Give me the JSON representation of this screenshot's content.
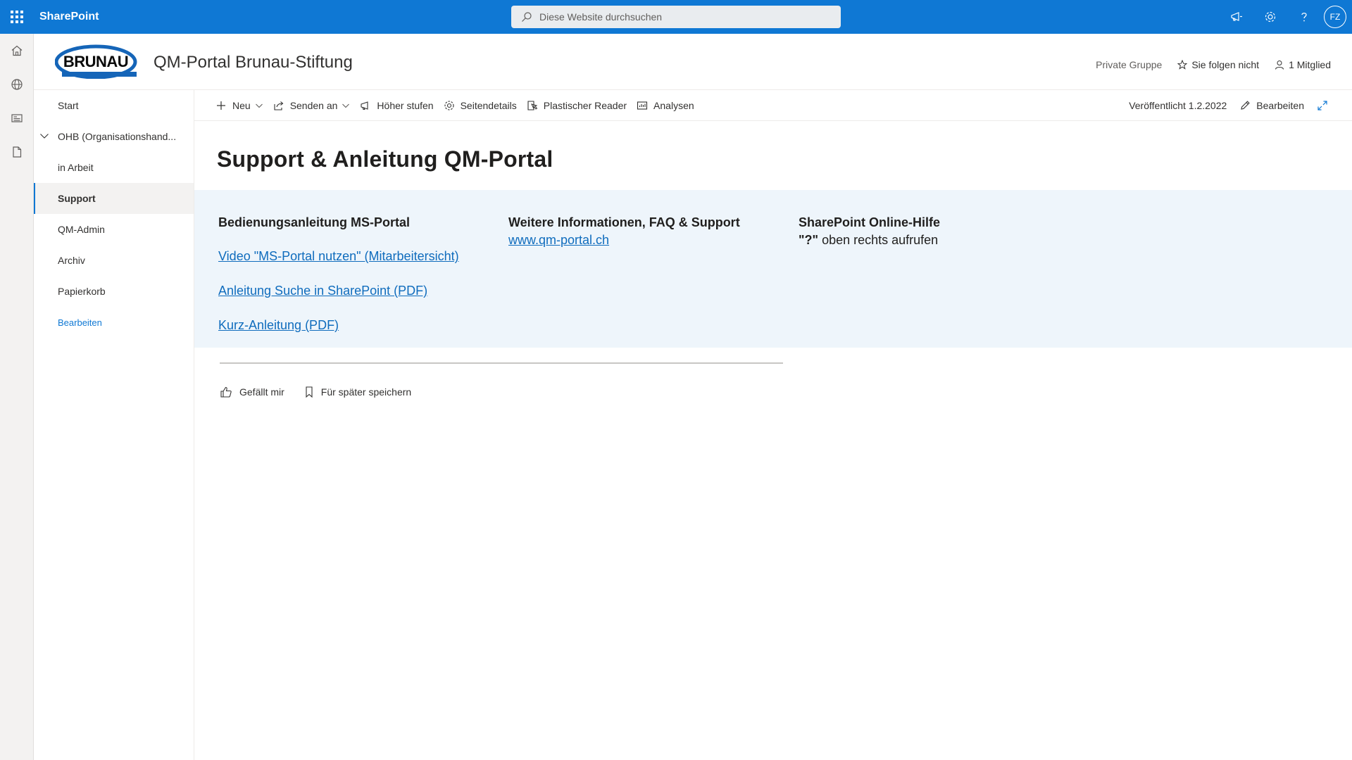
{
  "suite": {
    "brand": "SharePoint",
    "search_placeholder": "Diese Website durchsuchen",
    "avatar_initials": "FZ",
    "accent": "#0f78d4"
  },
  "site": {
    "logo_text": "BRUNAU",
    "title": "QM-Portal Brunau-Stiftung",
    "privacy": "Private Gruppe",
    "follow": "Sie folgen nicht",
    "members": "1 Mitglied"
  },
  "nav": {
    "items": [
      {
        "label": "Start"
      },
      {
        "label": "OHB (Organisationshand..."
      },
      {
        "label": "in Arbeit"
      },
      {
        "label": "Support"
      },
      {
        "label": "QM-Admin"
      },
      {
        "label": "Archiv"
      },
      {
        "label": "Papierkorb"
      }
    ],
    "edit_label": "Bearbeiten"
  },
  "commandbar": {
    "new": "Neu",
    "send": "Senden an",
    "promote": "Höher stufen",
    "details": "Seitendetails",
    "reader": "Plastischer Reader",
    "analytics": "Analysen",
    "published": "Veröffentlicht 1.2.2022",
    "edit": "Bearbeiten"
  },
  "page": {
    "title": "Support & Anleitung QM-Portal",
    "columns": [
      {
        "heading": "Bedienungsanleitung MS-Portal",
        "links": [
          "Video \"MS-Portal nutzen\" (Mitarbeitersicht)",
          "Anleitung Suche in SharePoint (PDF)",
          "Kurz-Anleitung (PDF)"
        ]
      },
      {
        "heading": "Weitere Informationen, FAQ & Support",
        "link": "www.qm-portal.ch"
      },
      {
        "heading": "SharePoint Online-Hilfe",
        "text_bold": "\"?\"",
        "text_rest": " oben rechts aufrufen"
      }
    ],
    "like": "Gefällt mir",
    "save_for_later": "Für später speichern"
  }
}
